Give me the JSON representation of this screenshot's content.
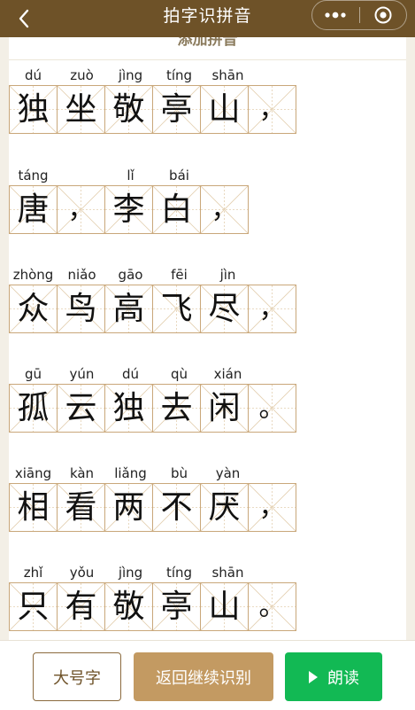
{
  "nav": {
    "title": "拍字识拼音"
  },
  "section_title": "添加拼音",
  "lines": [
    {
      "pinyin": [
        "dú",
        "zuò",
        "jìng",
        "tíng",
        "shān",
        ""
      ],
      "chars": [
        "独",
        "坐",
        "敬",
        "亭",
        "山",
        "，"
      ]
    },
    {
      "pinyin": [
        "táng",
        "",
        "lǐ",
        "bái",
        ""
      ],
      "chars": [
        "唐",
        "，",
        "李",
        "白",
        "，"
      ]
    },
    {
      "pinyin": [
        "zhòng",
        "niǎo",
        "gāo",
        "fēi",
        "jìn",
        ""
      ],
      "chars": [
        "众",
        "鸟",
        "高",
        "飞",
        "尽",
        "，"
      ]
    },
    {
      "pinyin": [
        "gū",
        "yún",
        "dú",
        "qù",
        "xián",
        ""
      ],
      "chars": [
        "孤",
        "云",
        "独",
        "去",
        "闲",
        "。"
      ]
    },
    {
      "pinyin": [
        "xiāng",
        "kàn",
        "liǎng",
        "bù",
        "yàn",
        ""
      ],
      "chars": [
        "相",
        "看",
        "两",
        "不",
        "厌",
        "，"
      ]
    },
    {
      "pinyin": [
        "zhǐ",
        "yǒu",
        "jìng",
        "tíng",
        "shān",
        ""
      ],
      "chars": [
        "只",
        "有",
        "敬",
        "亭",
        "山",
        "。"
      ]
    }
  ],
  "buttons": {
    "large_font": "大号字",
    "return_recognize": "返回继续识别",
    "read_aloud": "朗读"
  },
  "colors": {
    "nav_bg": "#6e5228",
    "grid_border": "#c9a77a",
    "return_button": "#c39a62",
    "read_button": "#12b954"
  },
  "icons": {
    "back": "chevron-left-icon",
    "more": "more-dots-icon",
    "close": "target-circle-icon",
    "play": "play-triangle-icon"
  }
}
